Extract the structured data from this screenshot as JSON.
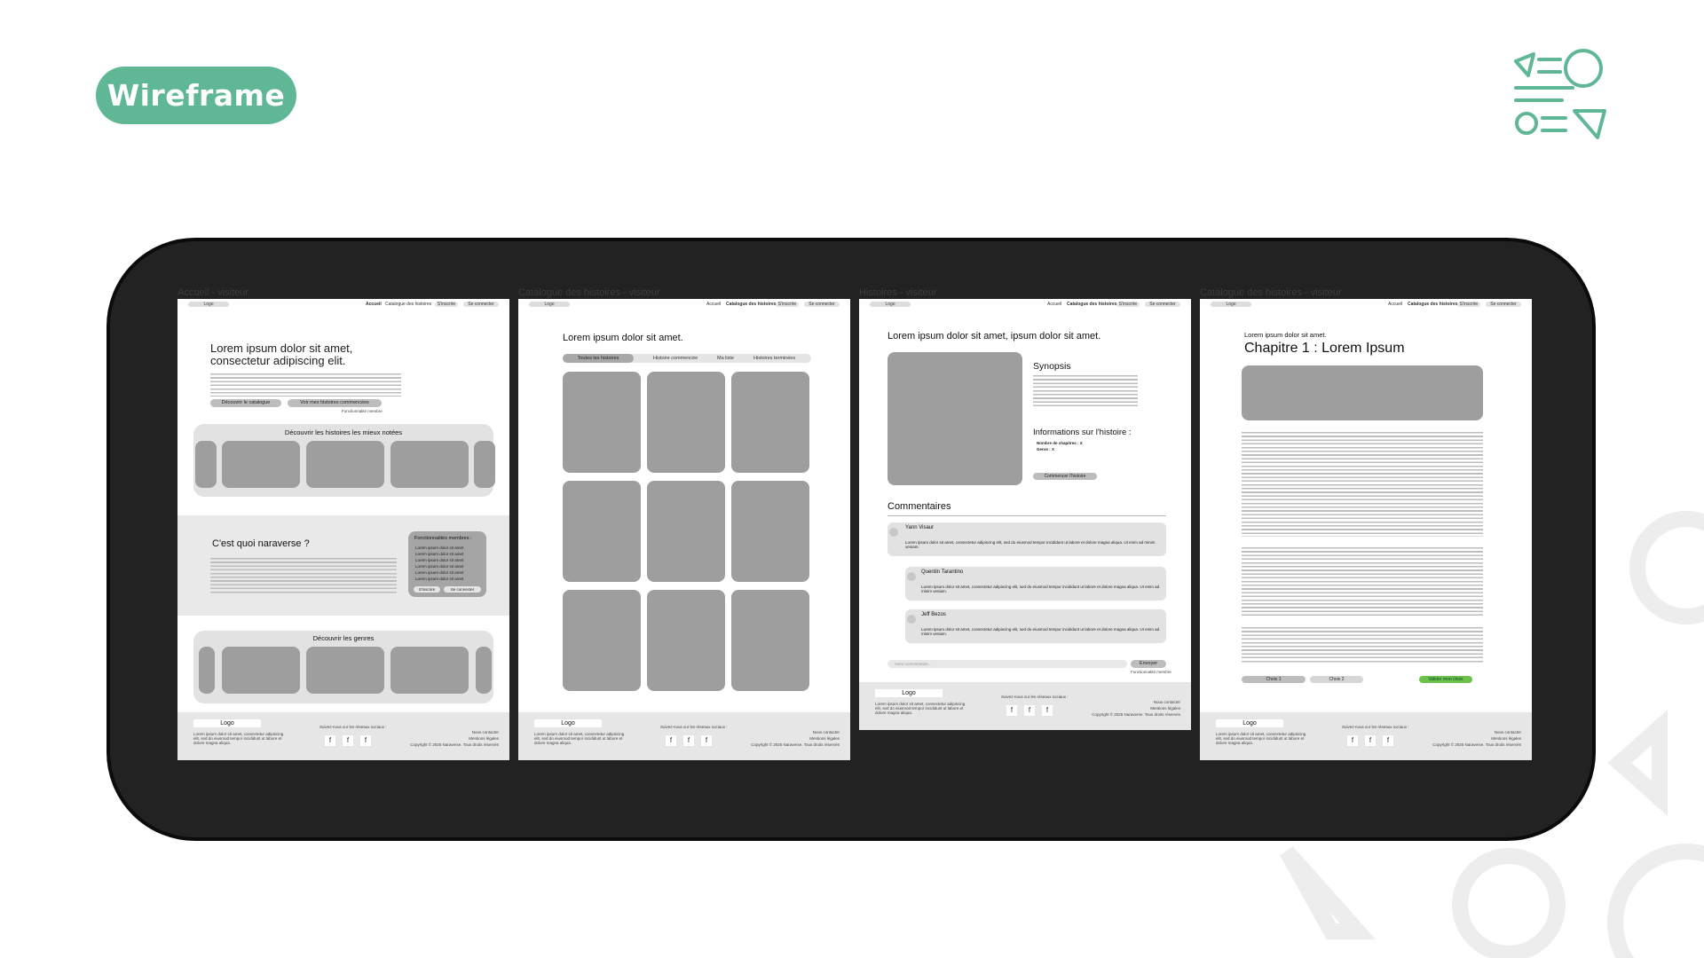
{
  "header": {
    "badge": "Wireframe"
  },
  "frames": {
    "labels": [
      "Accueil - visiteur",
      "Catalogue des histoires - visiteur",
      "Histoires - visiteur",
      "Catalogue des histoires - visiteur"
    ],
    "nav": {
      "logo": "Logo",
      "accueil": "Accueil",
      "catalogue": "Catalogue des histoires",
      "inscrire": "S'inscrire",
      "connecter": "Se connecter"
    },
    "footer": {
      "logo": "Logo",
      "text": "Lorem ipsum dolor sit amet, consectetur adipiscing elit, sed do eiusmod tempor incididunt ut labore et dolore magna aliqua.",
      "social_title": "Suivez-nous sur les réseaux sociaux :",
      "social_icon": "f",
      "contact": "Nous contacter",
      "legal": "Mentions légales",
      "copyright": "Copyright © 2025 Naraverse. Tous droits réservés"
    }
  },
  "accueil": {
    "hero_title_1": "Lorem ipsum dolor sit amet,",
    "hero_title_2": "consectetur adipiscing elit.",
    "btn_catalogue": "Découvrir le catalogue",
    "btn_histoires": "Voir mes histoires commencées",
    "member_note": "Fonctionnalité membre",
    "rated_title": "Découvrir les histoires les mieux notées",
    "about_title": "C'est quoi naraverse ?",
    "features_title": "Fonctionnalités membres :",
    "feature_item": "Lorem ipsum dolor sit amet",
    "btn_inscrire": "S'inscrire",
    "btn_connecter": "Se connecter",
    "genres_title": "Découvrir les genres"
  },
  "catalogue": {
    "title": "Lorem ipsum dolor sit amet.",
    "tabs": [
      "Toutes les histoires",
      "Histoire commencée",
      "Ma liste",
      "Histoires terminées"
    ]
  },
  "histoire": {
    "title": "Lorem ipsum dolor sit amet, ipsum dolor sit amet.",
    "synopsis": "Synopsis",
    "infos": "Informations sur l'histoire :",
    "info_items": [
      "Nombre de chapitres : X",
      "Genre : X"
    ],
    "btn_commencer": "Commencer l'histoire",
    "comments_title": "Commentaires",
    "comments": [
      {
        "name": "Yann Visaur",
        "text": "Lorem ipsum dolor sit amet, consectetur adipiscing elit, sed do eiusmod tempor incididunt ut labore et dolore magna aliqua. Ut enim ad minim veniam."
      },
      {
        "name": "Quentin Tarantino",
        "text": "Lorem ipsum dolor sit amet, consectetur adipiscing elit, sed do eiusmod tempor incididunt ut labore et dolore magna aliqua. Ut enim ad minim veniam."
      },
      {
        "name": "Jeff Bezos",
        "text": "Lorem ipsum dolor sit amet, consectetur adipiscing elit, sed do eiusmod tempor incididunt ut labore et dolore magna aliqua. Ut enim ad minim veniam."
      }
    ],
    "comment_placeholder": "Votre commentaire...",
    "btn_envoyer": "Envoyer",
    "member_note": "Fonctionnalité membre"
  },
  "chapitre": {
    "subtitle": "Lorem ipsum dolor sit amet.",
    "title": "Chapitre 1 : Lorem Ipsum",
    "choice_1": "Choix 1",
    "choice_2": "Choix 2",
    "btn_valider": "Valider mon choix"
  },
  "colors": {
    "accent": "#5fb796",
    "frame": "#222222"
  }
}
